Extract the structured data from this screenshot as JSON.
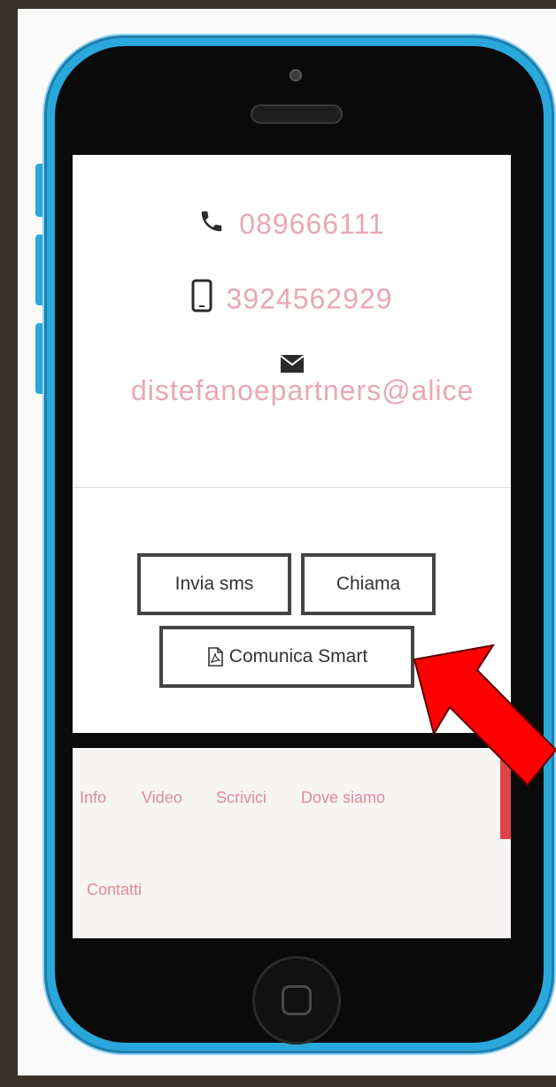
{
  "contacts": {
    "phone": "089666111",
    "mobile": "3924562929",
    "email": "distefanoepartners@alice"
  },
  "buttons": {
    "sms": "Invia sms",
    "call": "Chiama",
    "smart": "Comunica Smart"
  },
  "nav": {
    "items": [
      "Info",
      "Video",
      "Scrivici",
      "Dove siamo",
      "Contatti"
    ]
  },
  "icons": {
    "phone": "phone-icon",
    "mobile": "mobile-icon",
    "email": "envelope-icon",
    "pdf": "pdf-icon",
    "arrow": "red-arrow-icon",
    "home": "home-button-icon"
  },
  "colors": {
    "phone_body": "#2aa8dc",
    "contact_text": "#e8a8b4",
    "nav_text": "#e08a98",
    "arrow": "#ff0000",
    "page_bg": "#3a3228"
  }
}
